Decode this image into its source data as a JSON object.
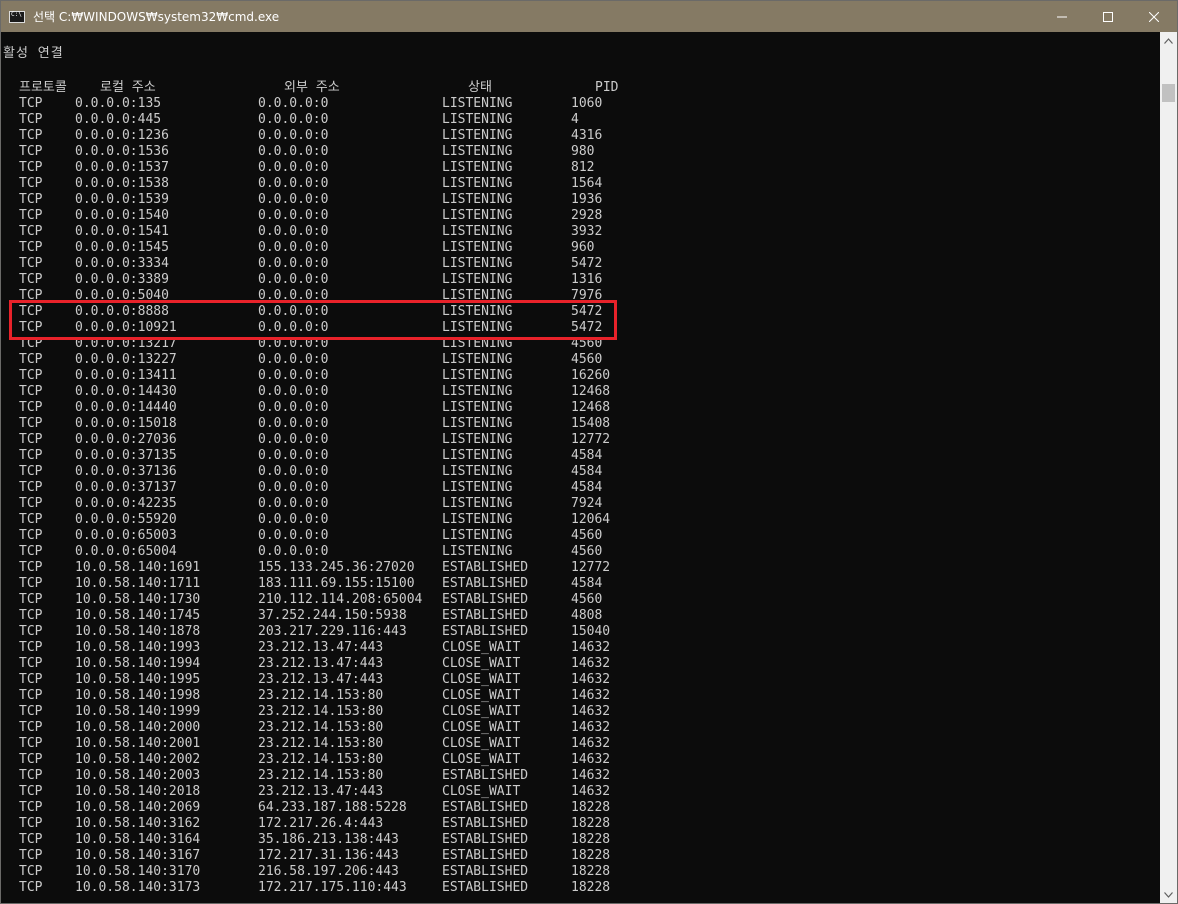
{
  "window": {
    "title": "선택 C:₩WINDOWS₩system32₩cmd.exe",
    "minimize_icon": "minimize-icon",
    "maximize_icon": "maximize-icon",
    "close_icon": "close-icon"
  },
  "console": {
    "heading": "활성 연결",
    "columns": {
      "proto": "프로토콜",
      "local": "로컬 주소",
      "foreign": "외부 주소",
      "state": "상태",
      "pid": "PID"
    },
    "rows": [
      {
        "proto": "TCP",
        "local": "0.0.0.0:135",
        "foreign": "0.0.0.0:0",
        "state": "LISTENING",
        "pid": "1060"
      },
      {
        "proto": "TCP",
        "local": "0.0.0.0:445",
        "foreign": "0.0.0.0:0",
        "state": "LISTENING",
        "pid": "4"
      },
      {
        "proto": "TCP",
        "local": "0.0.0.0:1236",
        "foreign": "0.0.0.0:0",
        "state": "LISTENING",
        "pid": "4316"
      },
      {
        "proto": "TCP",
        "local": "0.0.0.0:1536",
        "foreign": "0.0.0.0:0",
        "state": "LISTENING",
        "pid": "980"
      },
      {
        "proto": "TCP",
        "local": "0.0.0.0:1537",
        "foreign": "0.0.0.0:0",
        "state": "LISTENING",
        "pid": "812"
      },
      {
        "proto": "TCP",
        "local": "0.0.0.0:1538",
        "foreign": "0.0.0.0:0",
        "state": "LISTENING",
        "pid": "1564"
      },
      {
        "proto": "TCP",
        "local": "0.0.0.0:1539",
        "foreign": "0.0.0.0:0",
        "state": "LISTENING",
        "pid": "1936"
      },
      {
        "proto": "TCP",
        "local": "0.0.0.0:1540",
        "foreign": "0.0.0.0:0",
        "state": "LISTENING",
        "pid": "2928"
      },
      {
        "proto": "TCP",
        "local": "0.0.0.0:1541",
        "foreign": "0.0.0.0:0",
        "state": "LISTENING",
        "pid": "3932"
      },
      {
        "proto": "TCP",
        "local": "0.0.0.0:1545",
        "foreign": "0.0.0.0:0",
        "state": "LISTENING",
        "pid": "960"
      },
      {
        "proto": "TCP",
        "local": "0.0.0.0:3334",
        "foreign": "0.0.0.0:0",
        "state": "LISTENING",
        "pid": "5472"
      },
      {
        "proto": "TCP",
        "local": "0.0.0.0:3389",
        "foreign": "0.0.0.0:0",
        "state": "LISTENING",
        "pid": "1316"
      },
      {
        "proto": "TCP",
        "local": "0.0.0.0:5040",
        "foreign": "0.0.0.0:0",
        "state": "LISTENING",
        "pid": "7976"
      },
      {
        "proto": "TCP",
        "local": "0.0.0.0:8888",
        "foreign": "0.0.0.0:0",
        "state": "LISTENING",
        "pid": "5472"
      },
      {
        "proto": "TCP",
        "local": "0.0.0.0:10921",
        "foreign": "0.0.0.0:0",
        "state": "LISTENING",
        "pid": "5472"
      },
      {
        "proto": "TCP",
        "local": "0.0.0.0:13217",
        "foreign": "0.0.0.0:0",
        "state": "LISTENING",
        "pid": "4560"
      },
      {
        "proto": "TCP",
        "local": "0.0.0.0:13227",
        "foreign": "0.0.0.0:0",
        "state": "LISTENING",
        "pid": "4560"
      },
      {
        "proto": "TCP",
        "local": "0.0.0.0:13411",
        "foreign": "0.0.0.0:0",
        "state": "LISTENING",
        "pid": "16260"
      },
      {
        "proto": "TCP",
        "local": "0.0.0.0:14430",
        "foreign": "0.0.0.0:0",
        "state": "LISTENING",
        "pid": "12468"
      },
      {
        "proto": "TCP",
        "local": "0.0.0.0:14440",
        "foreign": "0.0.0.0:0",
        "state": "LISTENING",
        "pid": "12468"
      },
      {
        "proto": "TCP",
        "local": "0.0.0.0:15018",
        "foreign": "0.0.0.0:0",
        "state": "LISTENING",
        "pid": "15408"
      },
      {
        "proto": "TCP",
        "local": "0.0.0.0:27036",
        "foreign": "0.0.0.0:0",
        "state": "LISTENING",
        "pid": "12772"
      },
      {
        "proto": "TCP",
        "local": "0.0.0.0:37135",
        "foreign": "0.0.0.0:0",
        "state": "LISTENING",
        "pid": "4584"
      },
      {
        "proto": "TCP",
        "local": "0.0.0.0:37136",
        "foreign": "0.0.0.0:0",
        "state": "LISTENING",
        "pid": "4584"
      },
      {
        "proto": "TCP",
        "local": "0.0.0.0:37137",
        "foreign": "0.0.0.0:0",
        "state": "LISTENING",
        "pid": "4584"
      },
      {
        "proto": "TCP",
        "local": "0.0.0.0:42235",
        "foreign": "0.0.0.0:0",
        "state": "LISTENING",
        "pid": "7924"
      },
      {
        "proto": "TCP",
        "local": "0.0.0.0:55920",
        "foreign": "0.0.0.0:0",
        "state": "LISTENING",
        "pid": "12064"
      },
      {
        "proto": "TCP",
        "local": "0.0.0.0:65003",
        "foreign": "0.0.0.0:0",
        "state": "LISTENING",
        "pid": "4560"
      },
      {
        "proto": "TCP",
        "local": "0.0.0.0:65004",
        "foreign": "0.0.0.0:0",
        "state": "LISTENING",
        "pid": "4560"
      },
      {
        "proto": "TCP",
        "local": "10.0.58.140:1691",
        "foreign": "155.133.245.36:27020",
        "state": "ESTABLISHED",
        "pid": "12772"
      },
      {
        "proto": "TCP",
        "local": "10.0.58.140:1711",
        "foreign": "183.111.69.155:15100",
        "state": "ESTABLISHED",
        "pid": "4584"
      },
      {
        "proto": "TCP",
        "local": "10.0.58.140:1730",
        "foreign": "210.112.114.208:65004",
        "state": "ESTABLISHED",
        "pid": "4560"
      },
      {
        "proto": "TCP",
        "local": "10.0.58.140:1745",
        "foreign": "37.252.244.150:5938",
        "state": "ESTABLISHED",
        "pid": "4808"
      },
      {
        "proto": "TCP",
        "local": "10.0.58.140:1878",
        "foreign": "203.217.229.116:443",
        "state": "ESTABLISHED",
        "pid": "15040"
      },
      {
        "proto": "TCP",
        "local": "10.0.58.140:1993",
        "foreign": "23.212.13.47:443",
        "state": "CLOSE_WAIT",
        "pid": "14632"
      },
      {
        "proto": "TCP",
        "local": "10.0.58.140:1994",
        "foreign": "23.212.13.47:443",
        "state": "CLOSE_WAIT",
        "pid": "14632"
      },
      {
        "proto": "TCP",
        "local": "10.0.58.140:1995",
        "foreign": "23.212.13.47:443",
        "state": "CLOSE_WAIT",
        "pid": "14632"
      },
      {
        "proto": "TCP",
        "local": "10.0.58.140:1998",
        "foreign": "23.212.14.153:80",
        "state": "CLOSE_WAIT",
        "pid": "14632"
      },
      {
        "proto": "TCP",
        "local": "10.0.58.140:1999",
        "foreign": "23.212.14.153:80",
        "state": "CLOSE_WAIT",
        "pid": "14632"
      },
      {
        "proto": "TCP",
        "local": "10.0.58.140:2000",
        "foreign": "23.212.14.153:80",
        "state": "CLOSE_WAIT",
        "pid": "14632"
      },
      {
        "proto": "TCP",
        "local": "10.0.58.140:2001",
        "foreign": "23.212.14.153:80",
        "state": "CLOSE_WAIT",
        "pid": "14632"
      },
      {
        "proto": "TCP",
        "local": "10.0.58.140:2002",
        "foreign": "23.212.14.153:80",
        "state": "CLOSE_WAIT",
        "pid": "14632"
      },
      {
        "proto": "TCP",
        "local": "10.0.58.140:2003",
        "foreign": "23.212.14.153:80",
        "state": "ESTABLISHED",
        "pid": "14632"
      },
      {
        "proto": "TCP",
        "local": "10.0.58.140:2018",
        "foreign": "23.212.13.47:443",
        "state": "CLOSE_WAIT",
        "pid": "14632"
      },
      {
        "proto": "TCP",
        "local": "10.0.58.140:2069",
        "foreign": "64.233.187.188:5228",
        "state": "ESTABLISHED",
        "pid": "18228"
      },
      {
        "proto": "TCP",
        "local": "10.0.58.140:3162",
        "foreign": "172.217.26.4:443",
        "state": "ESTABLISHED",
        "pid": "18228"
      },
      {
        "proto": "TCP",
        "local": "10.0.58.140:3164",
        "foreign": "35.186.213.138:443",
        "state": "ESTABLISHED",
        "pid": "18228"
      },
      {
        "proto": "TCP",
        "local": "10.0.58.140:3167",
        "foreign": "172.217.31.136:443",
        "state": "ESTABLISHED",
        "pid": "18228"
      },
      {
        "proto": "TCP",
        "local": "10.0.58.140:3170",
        "foreign": "216.58.197.206:443",
        "state": "ESTABLISHED",
        "pid": "18228"
      },
      {
        "proto": "TCP",
        "local": "10.0.58.140:3173",
        "foreign": "172.217.175.110:443",
        "state": "ESTABLISHED",
        "pid": "18228"
      }
    ],
    "highlighted_rows": [
      13,
      14
    ],
    "highlight_color": "#e8222a"
  },
  "colors": {
    "titlebar": "#857a64",
    "console_bg": "#0c0c0c",
    "console_text": "#cccccc"
  },
  "scrollbar": {
    "up_icon": "scroll-up-arrow-icon",
    "down_icon": "scroll-down-arrow-icon"
  }
}
